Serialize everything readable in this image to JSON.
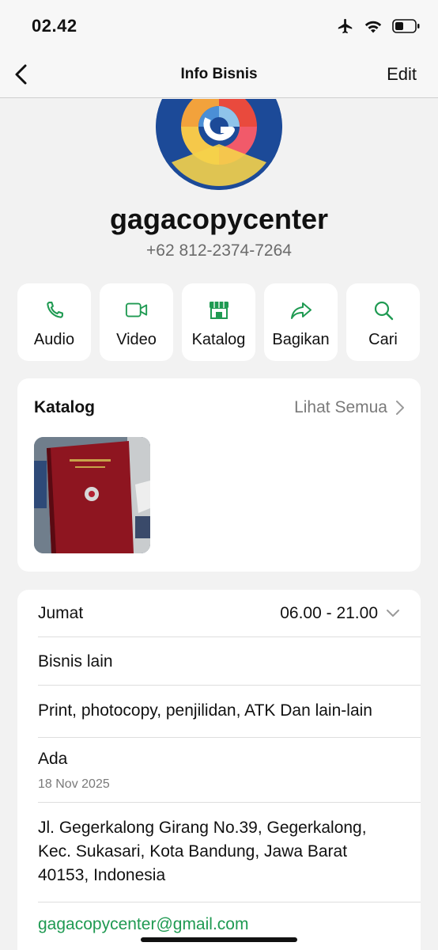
{
  "status": {
    "time": "02.42"
  },
  "nav": {
    "title": "Info Bisnis",
    "edit_label": "Edit"
  },
  "profile": {
    "name": "gagacopycenter",
    "phone": "+62 812-2374-7264"
  },
  "actions": [
    {
      "label": "Audio",
      "icon": "phone-icon"
    },
    {
      "label": "Video",
      "icon": "video-icon"
    },
    {
      "label": "Katalog",
      "icon": "store-icon"
    },
    {
      "label": "Bagikan",
      "icon": "share-icon"
    },
    {
      "label": "Cari",
      "icon": "search-icon"
    }
  ],
  "catalog": {
    "title": "Katalog",
    "see_all": "Lihat Semua"
  },
  "info": {
    "hours_day": "Jumat",
    "hours_time": "06.00 - 21.00",
    "category": "Bisnis lain",
    "description": "Print, photocopy, penjilidan, ATK Dan lain-lain",
    "since_label": "Ada",
    "since_date": "18 Nov 2025",
    "address": "Jl. Gegerkalong Girang No.39, Gegerkalong, Kec. Sukasari, Kota Bandung, Jawa Barat 40153, Indonesia",
    "email": "gagacopycenter@gmail.com"
  },
  "colors": {
    "accent": "#1f9a52",
    "background": "#f2f2f2",
    "card": "#ffffff"
  }
}
